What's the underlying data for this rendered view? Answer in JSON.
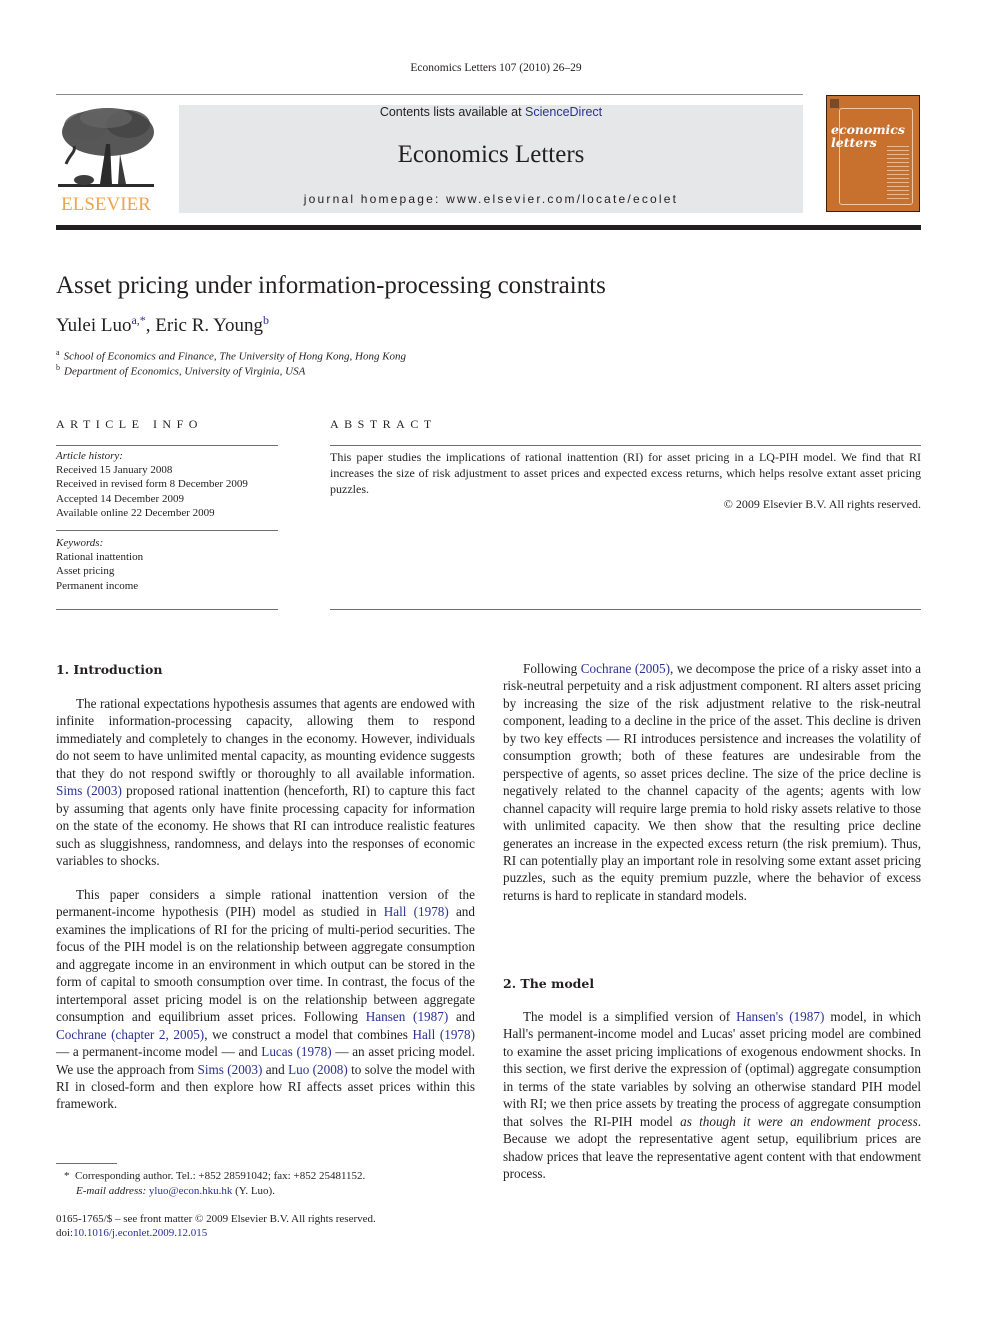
{
  "running_head": "Economics Letters 107 (2010) 26–29",
  "masthead": {
    "publisher_logo_word": "ELSEVIER",
    "contents_prefix": "Contents lists available at ",
    "contents_link": "ScienceDirect",
    "journal_title": "Economics Letters",
    "homepage": "journal homepage: www.elsevier.com/locate/ecolet",
    "cover_title_line1": "economics",
    "cover_title_line2": "letters"
  },
  "colors": {
    "link": "#2a3192",
    "elsevier_orange": "#f0a34a",
    "cover_brown": "#c8702e",
    "masthead_grey": "#e6e7e8"
  },
  "article": {
    "title": "Asset pricing under information-processing constraints",
    "authors": [
      {
        "name": "Yulei Luo",
        "marks": "a,*"
      },
      {
        "name": "Eric R. Young",
        "marks": "b"
      }
    ],
    "author_separator": ", ",
    "affiliations": [
      {
        "mark": "a",
        "text": "School of Economics and Finance, The University of Hong Kong, Hong Kong"
      },
      {
        "mark": "b",
        "text": "Department of Economics, University of Virginia, USA"
      }
    ]
  },
  "article_info": {
    "heading": "ARTICLE INFO",
    "history_label": "Article history:",
    "history": [
      "Received 15 January 2008",
      "Received in revised form 8 December 2009",
      "Accepted 14 December 2009",
      "Available online 22 December 2009"
    ],
    "keywords_label": "Keywords:",
    "keywords": [
      "Rational inattention",
      "Asset pricing",
      "Permanent income"
    ]
  },
  "abstract": {
    "heading": "ABSTRACT",
    "text": "This paper studies the implications of rational inattention (RI) for asset pricing in a LQ-PIH model. We find that RI increases the size of risk adjustment to asset prices and expected excess returns, which helps resolve extant asset pricing puzzles.",
    "copyright": "© 2009 Elsevier B.V. All rights reserved."
  },
  "section1": {
    "heading": "1. Introduction",
    "p1": [
      "The rational expectations hypothesis assumes that agents are endowed with infinite information-processing capacity, allowing them to respond immediately and completely to changes in the economy. However, individuals do not seem to have unlimited mental capacity, as mounting evidence suggests that they do not respond swiftly or thoroughly to all available information. ",
      "Sims (2003)",
      " proposed rational inattention (henceforth, RI) to capture this fact by assuming that agents only have finite processing capacity for information on the state of the economy. He shows that RI can introduce realistic features such as sluggishness, randomness, and delays into the responses of economic variables to shocks."
    ],
    "p2": [
      "This paper considers a simple rational inattention version of the permanent-income hypothesis (PIH) model as studied in ",
      "Hall (1978)",
      " and examines the implications of RI for the pricing of multi-period securities. The focus of the PIH model is on the relationship between aggregate consumption and aggregate income in an environment in which output can be stored in the form of capital to smooth consumption over time. In contrast, the focus of the intertemporal asset pricing model is on the relationship between aggregate consumption and equilibrium asset prices. Following ",
      "Hansen (1987)",
      " and ",
      "Cochrane (chapter 2, 2005)",
      ", we construct a model that combines ",
      "Hall (1978)",
      " — a permanent-income model — and ",
      "Lucas (1978)",
      " — an asset pricing model. We use the approach from ",
      "Sims (2003)",
      " and ",
      "Luo (2008)",
      " to solve the model with RI in closed-form and then explore how RI affects asset prices within this framework."
    ],
    "p3": [
      "Following ",
      "Cochrane (2005)",
      ", we decompose the price of a risky asset into a risk-neutral perpetuity and a risk adjustment component. RI alters asset pricing by increasing the size of the risk adjustment relative to the risk-neutral component, leading to a decline in the price of the asset. This decline is driven by two key effects — RI introduces persistence and increases the volatility of consumption growth; both of these features are undesirable from the perspective of agents, so asset prices decline. The size of the price decline is negatively related to the channel capacity of the agents; agents with low channel capacity will require large premia to hold risky assets relative to those with unlimited capacity. We then show that the resulting price decline generates an increase in the expected excess return (the risk premium). Thus, RI can potentially play an important role in resolving some extant asset pricing puzzles, such as the equity premium puzzle, where the behavior of excess returns is hard to replicate in standard models."
    ]
  },
  "section2": {
    "heading": "2. The model",
    "p1": [
      "The model is a simplified version of ",
      "Hansen's (1987)",
      " model, in which Hall's permanent-income model and Lucas' asset pricing model are combined to examine the asset pricing implications of exogenous endowment shocks. In this section, we first derive the expression of (optimal) aggregate consumption in terms of the state variables by solving an otherwise standard PIH model with RI; we then price assets by treating the process of aggregate consumption that solves the RI-PIH model ",
      "as though it were an endowment process",
      ". Because we adopt the representative agent setup, equilibrium prices are shadow prices that leave the representative agent content with that endowment process."
    ]
  },
  "footnotes": {
    "corresponding_mark": "*",
    "corresponding_text": "Corresponding author. Tel.: +852 28591042; fax: +852 25481152.",
    "email_label": "E-mail address:",
    "email": "yluo@econ.hku.hk",
    "email_suffix": " (Y. Luo).",
    "front_matter": "0165-1765/$ – see front matter © 2009 Elsevier B.V. All rights reserved.",
    "doi_prefix": "doi:",
    "doi": "10.1016/j.econlet.2009.12.015"
  }
}
